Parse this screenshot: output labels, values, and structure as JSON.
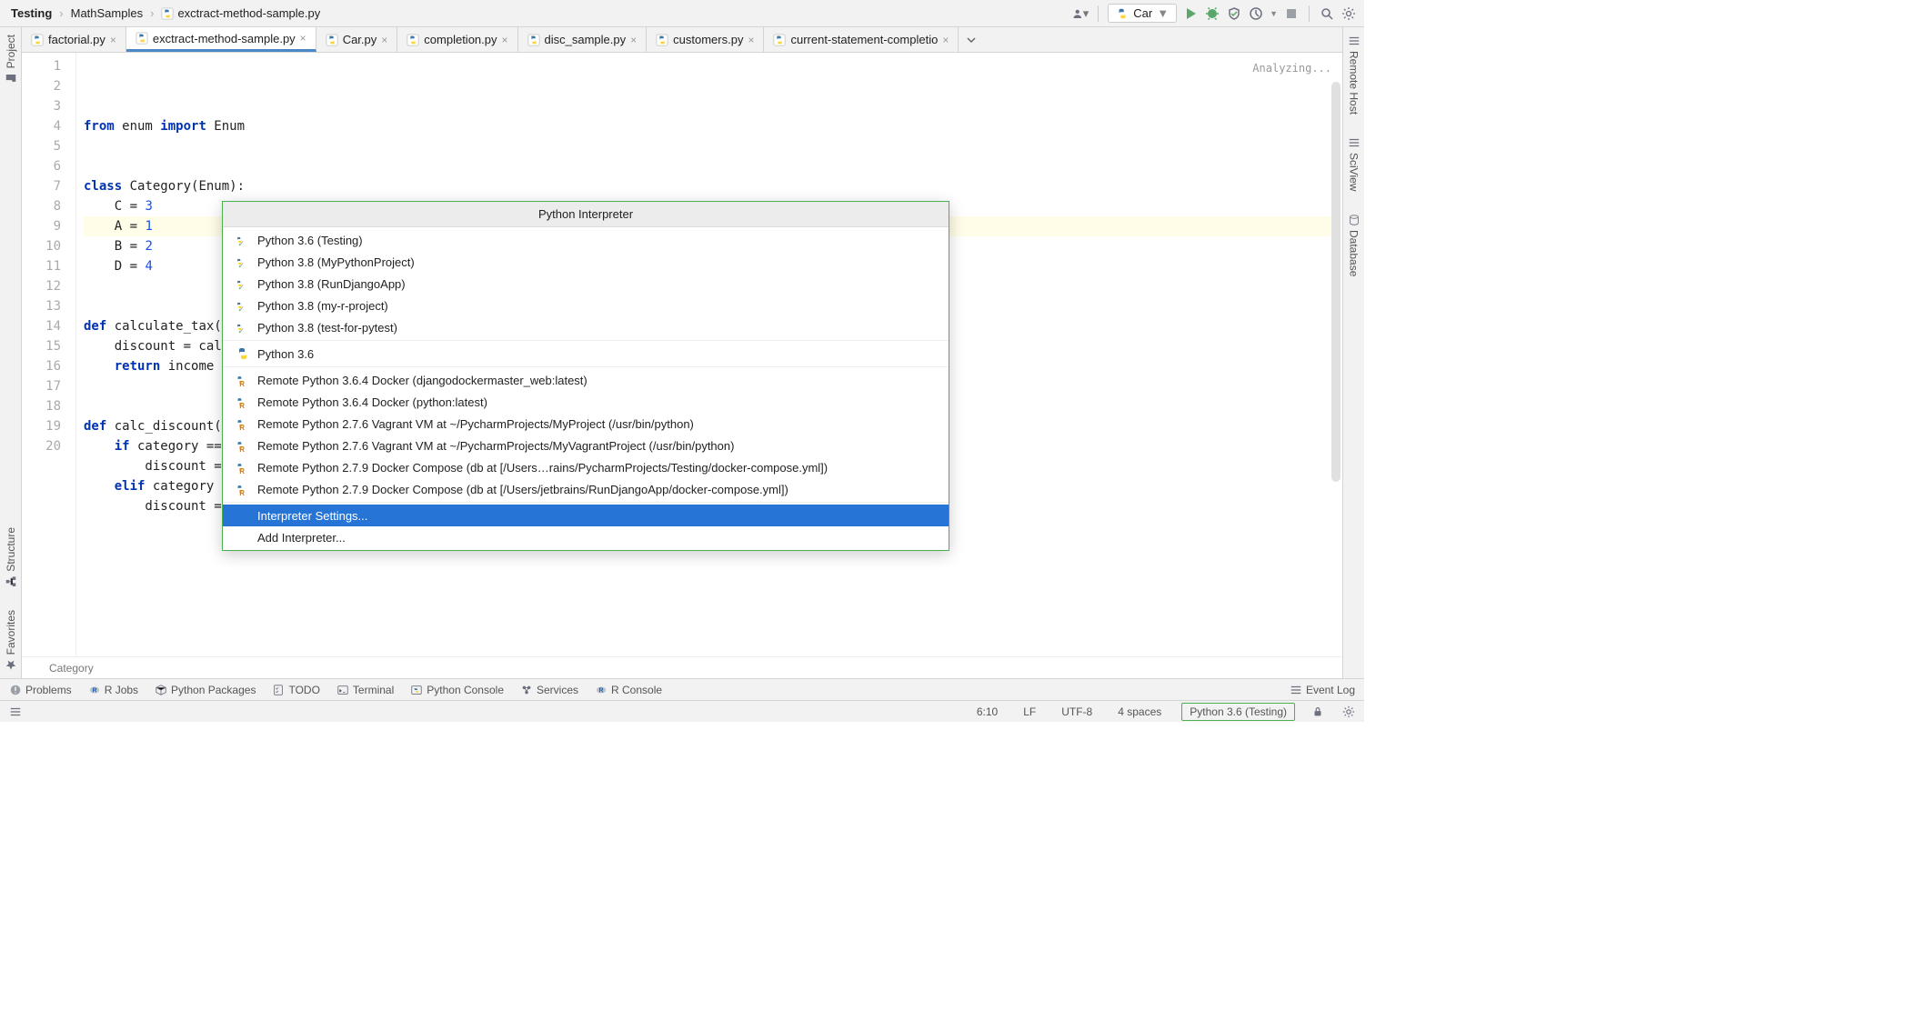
{
  "breadcrumbs": [
    "Testing",
    "MathSamples",
    "exctract-method-sample.py"
  ],
  "run_config": "Car",
  "tabs": [
    {
      "label": "factorial.py",
      "active": false
    },
    {
      "label": "exctract-method-sample.py",
      "active": true
    },
    {
      "label": "Car.py",
      "active": false
    },
    {
      "label": "completion.py",
      "active": false
    },
    {
      "label": "disc_sample.py",
      "active": false
    },
    {
      "label": "customers.py",
      "active": false
    },
    {
      "label": "current-statement-completio",
      "active": false
    }
  ],
  "editor": {
    "analyzing": "Analyzing...",
    "line_count": 20,
    "highlighted_line": 6,
    "lines": [
      {
        "n": 1,
        "html": "<span class='kw'>from</span> enum <span class='kw'>import</span> Enum"
      },
      {
        "n": 2,
        "html": ""
      },
      {
        "n": 3,
        "html": ""
      },
      {
        "n": 4,
        "html": "<span class='kw'>class</span> Category(Enum):"
      },
      {
        "n": 5,
        "html": "    C = <span class='num'>3</span>"
      },
      {
        "n": 6,
        "html": "    A = <span class='num'>1</span>"
      },
      {
        "n": 7,
        "html": "    B = <span class='num'>2</span>"
      },
      {
        "n": 8,
        "html": "    D = <span class='num'>4</span>"
      },
      {
        "n": 9,
        "html": ""
      },
      {
        "n": 10,
        "html": ""
      },
      {
        "n": 11,
        "html": "<span class='kw'>def</span> calculate_tax(ca"
      },
      {
        "n": 12,
        "html": "    discount = calc"
      },
      {
        "n": 13,
        "html": "    <span class='kw'>return</span> income *"
      },
      {
        "n": 14,
        "html": ""
      },
      {
        "n": 15,
        "html": ""
      },
      {
        "n": 16,
        "html": "<span class='kw'>def</span> calc_discount(ca"
      },
      {
        "n": 17,
        "html": "    <span class='kw'>if</span> category == "
      },
      {
        "n": 18,
        "html": "        discount = "
      },
      {
        "n": 19,
        "html": "    <span class='kw'>elif</span> category ="
      },
      {
        "n": 20,
        "html": "        discount = "
      }
    ],
    "crumb": "Category"
  },
  "left_tools": [
    "Project",
    "Structure",
    "Favorites"
  ],
  "right_tools": [
    "Remote Host",
    "SciView",
    "Database"
  ],
  "bottom_tools": [
    "Problems",
    "R Jobs",
    "Python Packages",
    "TODO",
    "Terminal",
    "Python Console",
    "Services",
    "R Console",
    "Event Log"
  ],
  "status": {
    "cursor": "6:10",
    "line_ending": "LF",
    "encoding": "UTF-8",
    "indent": "4 spaces",
    "interpreter": "Python 3.6 (Testing)"
  },
  "popup": {
    "title": "Python Interpreter",
    "sections": [
      {
        "icon": "pyv",
        "items": [
          "Python 3.6 (Testing)",
          "Python 3.8 (MyPythonProject)",
          "Python 3.8 (RunDjangoApp)",
          "Python 3.8 (my-r-project)",
          "Python 3.8 (test-for-pytest)"
        ]
      },
      {
        "icon": "py",
        "items": [
          "Python 3.6"
        ]
      },
      {
        "icon": "pyr",
        "items": [
          "Remote Python 3.6.4 Docker (djangodockermaster_web:latest)",
          "Remote Python 3.6.4 Docker (python:latest)",
          "Remote Python 2.7.6 Vagrant VM at ~/PycharmProjects/MyProject (/usr/bin/python)",
          "Remote Python 2.7.6 Vagrant VM at ~/PycharmProjects/MyVagrantProject (/usr/bin/python)",
          "Remote Python 2.7.9 Docker Compose (db at [/Users…rains/PycharmProjects/Testing/docker-compose.yml])",
          "Remote Python 2.7.9 Docker Compose (db at [/Users/jetbrains/RunDjangoApp/docker-compose.yml])"
        ]
      }
    ],
    "actions": [
      "Interpreter Settings...",
      "Add Interpreter..."
    ],
    "selected_action": "Interpreter Settings..."
  }
}
